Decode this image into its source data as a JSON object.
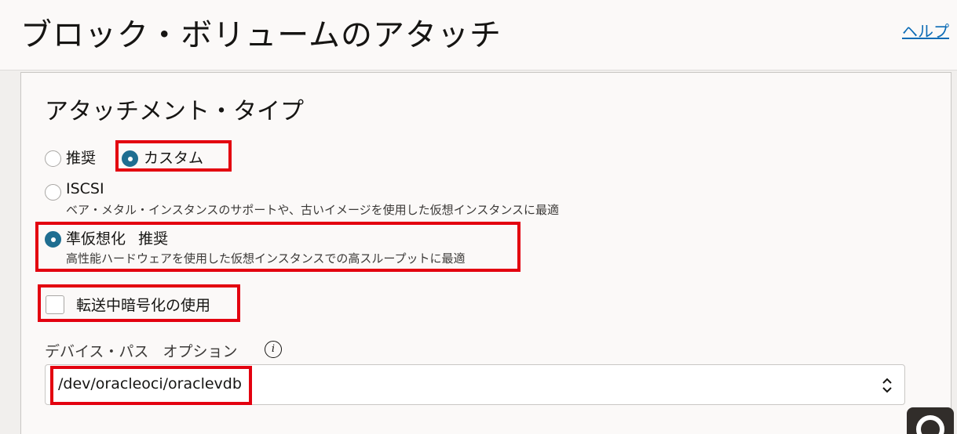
{
  "header": {
    "title": "ブロック・ボリュームのアタッチ",
    "help_label": "ヘルプ"
  },
  "attachment_type": {
    "title": "アタッチメント・タイプ",
    "options": [
      {
        "label": "推奨",
        "selected": false
      },
      {
        "label": "カスタム",
        "selected": true
      }
    ]
  },
  "custom_types": [
    {
      "label": "ISCSI",
      "description": "ベア・メタル・インスタンスのサポートや、古いイメージを使用した仮想インスタンスに最適",
      "selected": false
    },
    {
      "label": "準仮想化",
      "badge": "推奨",
      "description": "高性能ハードウェアを使用した仮想インスタンスでの高スループットに最適",
      "selected": true
    }
  ],
  "encryption": {
    "label": "転送中暗号化の使用",
    "checked": false
  },
  "device_path": {
    "label": "デバイス・パス",
    "optional_label": "オプション",
    "value": "/dev/oracleoci/oraclevdb"
  },
  "colors": {
    "accent": "#1f6e91",
    "highlight": "#e3000f",
    "link": "#0b6bb5"
  },
  "icons": {
    "info": "info-icon",
    "select_chevron": "chevron-up-down-icon",
    "support": "lifebuoy-icon"
  }
}
